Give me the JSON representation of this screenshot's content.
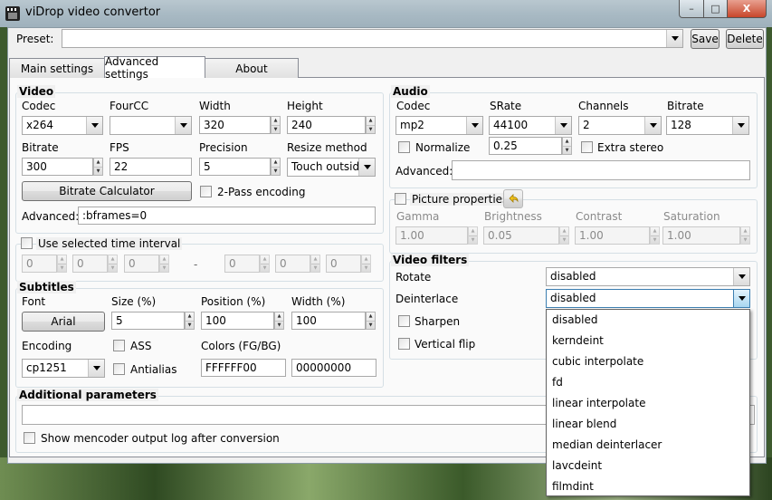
{
  "app": {
    "title": "viDrop video convertor"
  },
  "window_controls": {
    "minimize": "–",
    "maximize": "□",
    "close": "X"
  },
  "preset": {
    "label": "Preset:",
    "value": "",
    "save_label": "Save",
    "delete_label": "Delete"
  },
  "tabs": [
    {
      "label": "Main settings",
      "active": false
    },
    {
      "label": "Advanced settings",
      "active": true
    },
    {
      "label": "About",
      "active": false
    }
  ],
  "video": {
    "title": "Video",
    "codec_label": "Codec",
    "codec_value": "x264",
    "fourcc_label": "FourCC",
    "fourcc_value": "",
    "width_label": "Width",
    "width_value": "320",
    "height_label": "Height",
    "height_value": "240",
    "bitrate_label": "Bitrate",
    "bitrate_value": "300",
    "fps_label": "FPS",
    "fps_value": "22",
    "precision_label": "Precision",
    "precision_value": "5",
    "resize_label": "Resize method",
    "resize_value": "Touch outside",
    "bitrate_calc_label": "Bitrate Calculator",
    "twopass_label": "2-Pass encoding",
    "advanced_label": "Advanced:",
    "advanced_value": ":bframes=0"
  },
  "time_interval": {
    "label": "Use selected time interval",
    "start": [
      "0",
      "0",
      "0"
    ],
    "separator": "-",
    "end": [
      "0",
      "0",
      "0"
    ]
  },
  "subtitles": {
    "title": "Subtitles",
    "font_label": "Font",
    "font_button": "Arial",
    "size_label": "Size (%)",
    "size_value": "5",
    "position_label": "Position (%)",
    "position_value": "100",
    "width_label": "Width (%)",
    "width_value": "100",
    "encoding_label": "Encoding",
    "encoding_value": "cp1251",
    "ass_label": "ASS",
    "antialias_label": "Antialias",
    "colors_label": "Colors (FG/BG)",
    "fg_value": "FFFFFF00",
    "bg_value": "00000000"
  },
  "additional": {
    "title": "Additional parameters",
    "value": "",
    "log_label": "Show mencoder output log after conversion"
  },
  "audio": {
    "title": "Audio",
    "codec_label": "Codec",
    "codec_value": "mp2",
    "srate_label": "SRate",
    "srate_value": "44100",
    "channels_label": "Channels",
    "channels_value": "2",
    "bitrate_label": "Bitrate",
    "bitrate_value": "128",
    "normalize_label": "Normalize",
    "normalize_value": "0.25",
    "extra_stereo_label": "Extra stereo",
    "advanced_label": "Advanced:",
    "advanced_value": ""
  },
  "picture": {
    "label": "Picture properties",
    "gamma_label": "Gamma",
    "gamma_value": "1.00",
    "brightness_label": "Brightness",
    "brightness_value": "0.05",
    "contrast_label": "Contrast",
    "contrast_value": "1.00",
    "saturation_label": "Saturation",
    "saturation_value": "1.00"
  },
  "video_filters": {
    "title": "Video filters",
    "rotate_label": "Rotate",
    "rotate_value": "disabled",
    "deinterlace_label": "Deinterlace",
    "deinterlace_value": "disabled",
    "sharpen_label": "Sharpen",
    "vflip_label": "Vertical flip",
    "deinterlace_options": [
      "disabled",
      "kerndeint",
      "cubic interpolate",
      "fd",
      "linear interpolate",
      "linear blend",
      "median deinterlacer",
      "lavcdeint",
      "filmdint"
    ]
  }
}
